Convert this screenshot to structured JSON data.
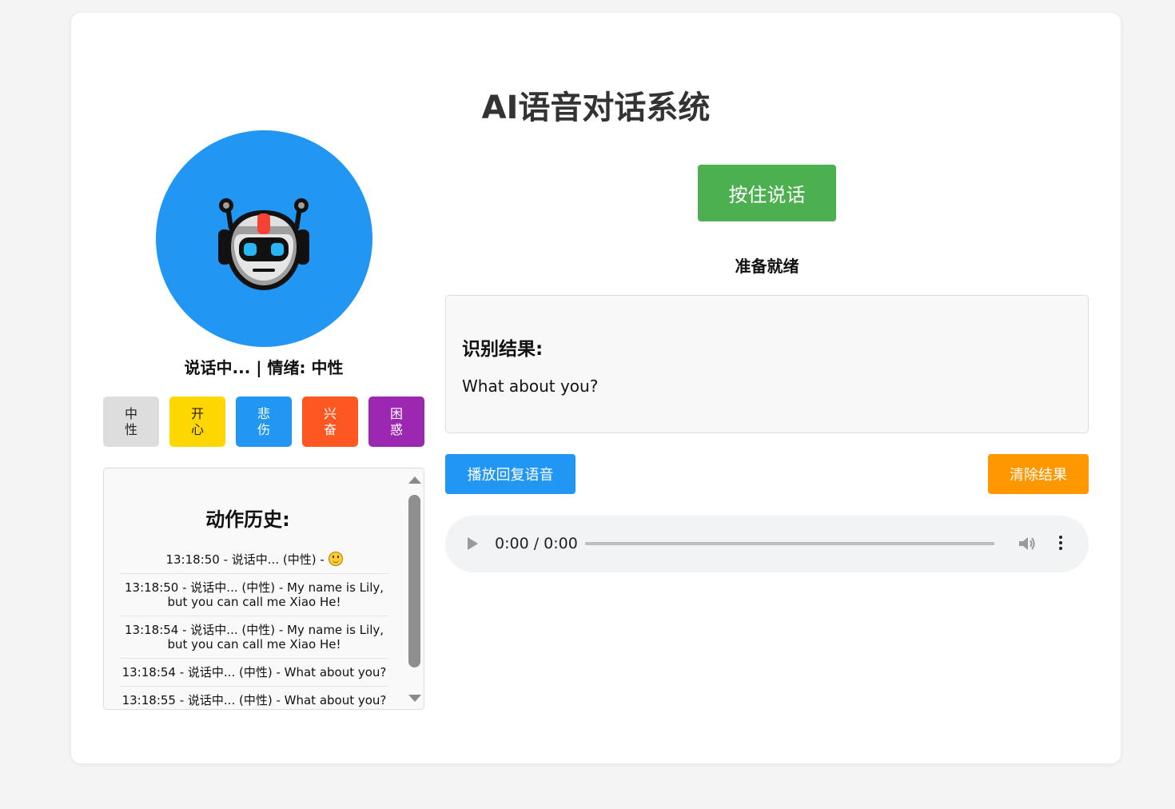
{
  "app": {
    "title": "AI语音对话系统"
  },
  "avatar": {
    "icon": "robot-icon",
    "background": "#2196f3"
  },
  "status": {
    "text": "说话中... | 情绪: 中性"
  },
  "emotions": [
    {
      "label": "中性",
      "color": "#dddddd",
      "text_color": "#222222"
    },
    {
      "label": "开心",
      "color": "#ffd700",
      "text_color": "#222222"
    },
    {
      "label": "悲伤",
      "color": "#2196f3",
      "text_color": "#ffffff"
    },
    {
      "label": "兴奋",
      "color": "#ff5722",
      "text_color": "#ffffff"
    },
    {
      "label": "困惑",
      "color": "#9c27b0",
      "text_color": "#ffffff"
    }
  ],
  "history": {
    "title": "动作历史:",
    "items": [
      {
        "text": "13:18:50 - 说话中... (中性) - "
      },
      {
        "text": "13:18:50 - 说话中... (中性) - My name is Lily, but you can call me Xiao He!"
      },
      {
        "text": "13:18:54 - 说话中... (中性) - My name is Lily, but you can call me Xiao He!"
      },
      {
        "text": "13:18:54 - 说话中... (中性) - What about you?"
      },
      {
        "text": "13:18:55 - 说话中... (中性) - What about you?"
      }
    ]
  },
  "controls": {
    "talk_label": "按住说话",
    "ready_text": "准备就绪",
    "play_label": "播放回复语音",
    "clear_label": "清除结果"
  },
  "result": {
    "title": "识别结果:",
    "text": "What about you?"
  },
  "audio": {
    "time": "0:00 / 0:00",
    "progress": 0
  },
  "colors": {
    "talk": "#4caf50",
    "play": "#2196f3",
    "clear": "#ff9800"
  }
}
